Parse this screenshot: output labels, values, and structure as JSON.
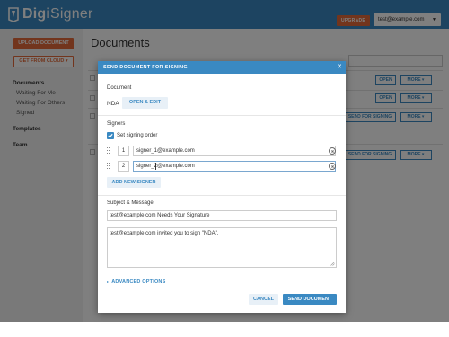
{
  "header": {
    "logo_text_bold": "Digi",
    "logo_text_rest": "Signer",
    "upgrade_label": "UPGRADE",
    "user_email": "test@example.com"
  },
  "sidebar": {
    "upload_label": "UPLOAD DOCUMENT",
    "cloud_label": "GET FROM CLOUD",
    "items": [
      {
        "label": "Documents"
      },
      {
        "label": "Waiting For Me"
      },
      {
        "label": "Waiting For Others"
      },
      {
        "label": "Signed"
      },
      {
        "label": "Templates"
      },
      {
        "label": "Team"
      }
    ]
  },
  "main": {
    "title": "Documents",
    "row_buttons": {
      "open": "OPEN",
      "more": "MORE",
      "send_for_signing": "SEND FOR SIGNING"
    }
  },
  "modal": {
    "title": "SEND DOCUMENT FOR SIGNING",
    "document_section_label": "Document",
    "document_name": "NDA",
    "open_edit_label": "OPEN & EDIT",
    "signers_section_label": "Signers",
    "signing_order_label": "Set signing order",
    "signing_order_checked": true,
    "signers": [
      {
        "order": "1",
        "email": "signer_1@example.com"
      },
      {
        "order": "2",
        "email": "signer_2@example.com"
      }
    ],
    "add_signer_label": "ADD NEW SIGNER",
    "subject_section_label": "Subject & Message",
    "subject": "test@example.com Needs Your Signature",
    "message": "test@example.com invited you to sign \"NDA\".",
    "advanced_options_label": "ADVANCED OPTIONS",
    "cancel_label": "CANCEL",
    "send_label": "SEND DOCUMENT"
  },
  "colors": {
    "primary": "#3a89c2",
    "accent_orange": "#e46b3a",
    "overlay": "rgba(0,0,0,0.5)"
  }
}
